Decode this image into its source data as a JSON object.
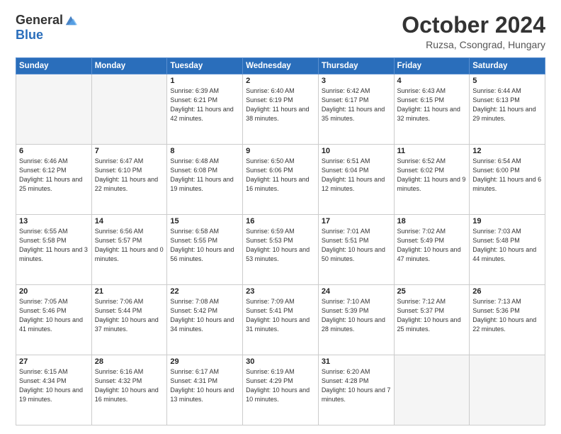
{
  "header": {
    "logo_general": "General",
    "logo_blue": "Blue",
    "title": "October 2024",
    "location": "Ruzsa, Csongrad, Hungary"
  },
  "weekdays": [
    "Sunday",
    "Monday",
    "Tuesday",
    "Wednesday",
    "Thursday",
    "Friday",
    "Saturday"
  ],
  "weeks": [
    [
      {
        "day": "",
        "empty": true
      },
      {
        "day": "",
        "empty": true
      },
      {
        "day": "1",
        "sunrise": "6:39 AM",
        "sunset": "6:21 PM",
        "daylight": "11 hours and 42 minutes."
      },
      {
        "day": "2",
        "sunrise": "6:40 AM",
        "sunset": "6:19 PM",
        "daylight": "11 hours and 38 minutes."
      },
      {
        "day": "3",
        "sunrise": "6:42 AM",
        "sunset": "6:17 PM",
        "daylight": "11 hours and 35 minutes."
      },
      {
        "day": "4",
        "sunrise": "6:43 AM",
        "sunset": "6:15 PM",
        "daylight": "11 hours and 32 minutes."
      },
      {
        "day": "5",
        "sunrise": "6:44 AM",
        "sunset": "6:13 PM",
        "daylight": "11 hours and 29 minutes."
      }
    ],
    [
      {
        "day": "6",
        "sunrise": "6:46 AM",
        "sunset": "6:12 PM",
        "daylight": "11 hours and 25 minutes."
      },
      {
        "day": "7",
        "sunrise": "6:47 AM",
        "sunset": "6:10 PM",
        "daylight": "11 hours and 22 minutes."
      },
      {
        "day": "8",
        "sunrise": "6:48 AM",
        "sunset": "6:08 PM",
        "daylight": "11 hours and 19 minutes."
      },
      {
        "day": "9",
        "sunrise": "6:50 AM",
        "sunset": "6:06 PM",
        "daylight": "11 hours and 16 minutes."
      },
      {
        "day": "10",
        "sunrise": "6:51 AM",
        "sunset": "6:04 PM",
        "daylight": "11 hours and 12 minutes."
      },
      {
        "day": "11",
        "sunrise": "6:52 AM",
        "sunset": "6:02 PM",
        "daylight": "11 hours and 9 minutes."
      },
      {
        "day": "12",
        "sunrise": "6:54 AM",
        "sunset": "6:00 PM",
        "daylight": "11 hours and 6 minutes."
      }
    ],
    [
      {
        "day": "13",
        "sunrise": "6:55 AM",
        "sunset": "5:58 PM",
        "daylight": "11 hours and 3 minutes."
      },
      {
        "day": "14",
        "sunrise": "6:56 AM",
        "sunset": "5:57 PM",
        "daylight": "11 hours and 0 minutes."
      },
      {
        "day": "15",
        "sunrise": "6:58 AM",
        "sunset": "5:55 PM",
        "daylight": "10 hours and 56 minutes."
      },
      {
        "day": "16",
        "sunrise": "6:59 AM",
        "sunset": "5:53 PM",
        "daylight": "10 hours and 53 minutes."
      },
      {
        "day": "17",
        "sunrise": "7:01 AM",
        "sunset": "5:51 PM",
        "daylight": "10 hours and 50 minutes."
      },
      {
        "day": "18",
        "sunrise": "7:02 AM",
        "sunset": "5:49 PM",
        "daylight": "10 hours and 47 minutes."
      },
      {
        "day": "19",
        "sunrise": "7:03 AM",
        "sunset": "5:48 PM",
        "daylight": "10 hours and 44 minutes."
      }
    ],
    [
      {
        "day": "20",
        "sunrise": "7:05 AM",
        "sunset": "5:46 PM",
        "daylight": "10 hours and 41 minutes."
      },
      {
        "day": "21",
        "sunrise": "7:06 AM",
        "sunset": "5:44 PM",
        "daylight": "10 hours and 37 minutes."
      },
      {
        "day": "22",
        "sunrise": "7:08 AM",
        "sunset": "5:42 PM",
        "daylight": "10 hours and 34 minutes."
      },
      {
        "day": "23",
        "sunrise": "7:09 AM",
        "sunset": "5:41 PM",
        "daylight": "10 hours and 31 minutes."
      },
      {
        "day": "24",
        "sunrise": "7:10 AM",
        "sunset": "5:39 PM",
        "daylight": "10 hours and 28 minutes."
      },
      {
        "day": "25",
        "sunrise": "7:12 AM",
        "sunset": "5:37 PM",
        "daylight": "10 hours and 25 minutes."
      },
      {
        "day": "26",
        "sunrise": "7:13 AM",
        "sunset": "5:36 PM",
        "daylight": "10 hours and 22 minutes."
      }
    ],
    [
      {
        "day": "27",
        "sunrise": "6:15 AM",
        "sunset": "4:34 PM",
        "daylight": "10 hours and 19 minutes."
      },
      {
        "day": "28",
        "sunrise": "6:16 AM",
        "sunset": "4:32 PM",
        "daylight": "10 hours and 16 minutes."
      },
      {
        "day": "29",
        "sunrise": "6:17 AM",
        "sunset": "4:31 PM",
        "daylight": "10 hours and 13 minutes."
      },
      {
        "day": "30",
        "sunrise": "6:19 AM",
        "sunset": "4:29 PM",
        "daylight": "10 hours and 10 minutes."
      },
      {
        "day": "31",
        "sunrise": "6:20 AM",
        "sunset": "4:28 PM",
        "daylight": "10 hours and 7 minutes."
      },
      {
        "day": "",
        "empty": true
      },
      {
        "day": "",
        "empty": true
      }
    ]
  ]
}
